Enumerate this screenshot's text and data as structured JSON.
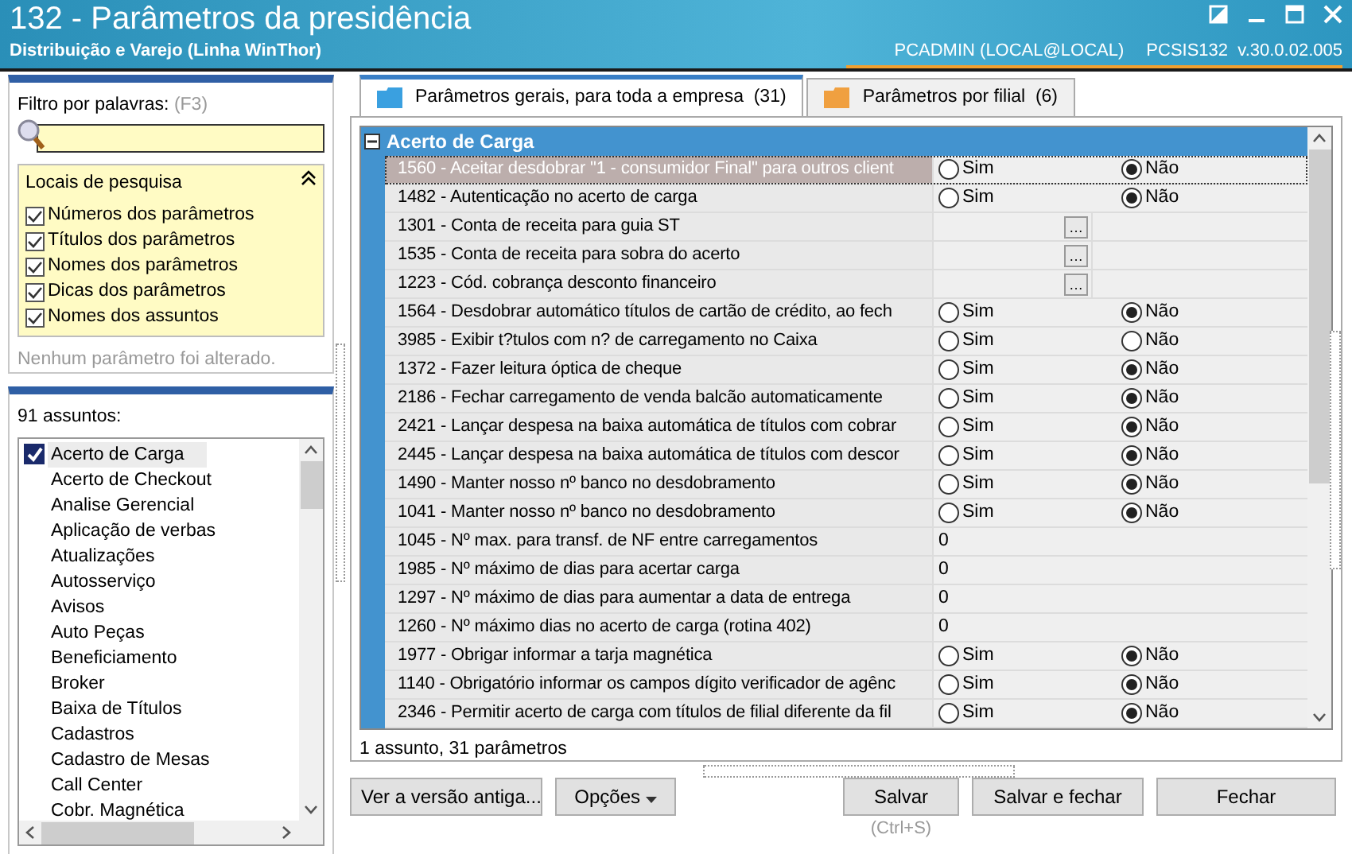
{
  "window": {
    "title": "132 - Parâmetros da presidência",
    "subtitle": "Distribuição e Varejo (Linha WinThor)",
    "user": "PCADMIN (LOCAL@LOCAL)",
    "version": "PCSIS132  v.30.0.02.005"
  },
  "filter": {
    "label": "Filtro por palavras:",
    "shortcut": "(F3)",
    "search_locations": {
      "title": "Locais de pesquisa",
      "expanded": true,
      "options": [
        {
          "label": "Números dos parâmetros",
          "checked": true
        },
        {
          "label": "Títulos dos parâmetros",
          "checked": true
        },
        {
          "label": "Nomes dos parâmetros",
          "checked": true
        },
        {
          "label": "Dicas dos parâmetros",
          "checked": true
        },
        {
          "label": "Nomes dos assuntos",
          "checked": true
        }
      ]
    },
    "status": "Nenhum parâmetro foi alterado."
  },
  "subjects": {
    "count_label": "91 assuntos:",
    "items": [
      {
        "label": "Acerto de Carga",
        "selected": true
      },
      {
        "label": "Acerto de Checkout",
        "selected": false
      },
      {
        "label": "Analise Gerencial",
        "selected": false
      },
      {
        "label": "Aplicação de verbas",
        "selected": false
      },
      {
        "label": "Atualizações",
        "selected": false
      },
      {
        "label": "Autosserviço",
        "selected": false
      },
      {
        "label": "Avisos",
        "selected": false
      },
      {
        "label": "Auto Peças",
        "selected": false
      },
      {
        "label": "Beneficiamento",
        "selected": false
      },
      {
        "label": "Broker",
        "selected": false
      },
      {
        "label": "Baixa de Títulos",
        "selected": false
      },
      {
        "label": "Cadastros",
        "selected": false
      },
      {
        "label": "Cadastro de Mesas",
        "selected": false
      },
      {
        "label": "Call Center",
        "selected": false
      },
      {
        "label": "Cobr. Magnética",
        "selected": false
      }
    ]
  },
  "tabs": [
    {
      "label": "Parâmetros gerais, para toda a empresa",
      "count": "(31)",
      "selected": true
    },
    {
      "label": "Parâmetros por filial",
      "count": "(6)",
      "selected": false
    }
  ],
  "grid": {
    "group": {
      "title": "Acerto de Carga",
      "expanded": true
    },
    "rows": [
      {
        "kind": "yesno",
        "label": "1560 - Aceitar desdobrar \"1 - consumidor Final\" para outros client",
        "selected": true,
        "yes": "Sim",
        "no": "Não",
        "yes_checked": false,
        "no_checked": true
      },
      {
        "kind": "yesno",
        "label": "1482 - Autenticação no acerto de carga",
        "selected": false,
        "yes": "Sim",
        "no": "Não",
        "yes_checked": false,
        "no_checked": true
      },
      {
        "kind": "lookup",
        "label": "1301 - Conta de receita para guia ST",
        "selected": false,
        "button": "…"
      },
      {
        "kind": "lookup",
        "label": "1535 - Conta de receita para sobra do acerto",
        "selected": false,
        "button": "…"
      },
      {
        "kind": "lookup",
        "label": "1223 - Cód. cobrança desconto financeiro",
        "selected": false,
        "button": "…"
      },
      {
        "kind": "yesno",
        "label": "1564 - Desdobrar automático títulos de cartão de crédito, ao fech",
        "selected": false,
        "yes": "Sim",
        "no": "Não",
        "yes_checked": false,
        "no_checked": true
      },
      {
        "kind": "yesno",
        "label": "3985 - Exibir t?tulos com n? de carregamento no Caixa",
        "selected": false,
        "yes": "Sim",
        "no": "Não",
        "yes_checked": false,
        "no_checked": false
      },
      {
        "kind": "yesno",
        "label": "1372 - Fazer leitura óptica de cheque",
        "selected": false,
        "yes": "Sim",
        "no": "Não",
        "yes_checked": false,
        "no_checked": true
      },
      {
        "kind": "yesno",
        "label": "2186 - Fechar carregamento de venda balcão automaticamente",
        "selected": false,
        "yes": "Sim",
        "no": "Não",
        "yes_checked": false,
        "no_checked": true
      },
      {
        "kind": "yesno",
        "label": "2421 - Lançar despesa na baixa automática de títulos com cobrar",
        "selected": false,
        "yes": "Sim",
        "no": "Não",
        "yes_checked": false,
        "no_checked": true
      },
      {
        "kind": "yesno",
        "label": "2445 - Lançar despesa na baixa automática de títulos com descor",
        "selected": false,
        "yes": "Sim",
        "no": "Não",
        "yes_checked": false,
        "no_checked": true
      },
      {
        "kind": "yesno",
        "label": "1490 - Manter nosso nº banco no desdobramento",
        "selected": false,
        "yes": "Sim",
        "no": "Não",
        "yes_checked": false,
        "no_checked": true
      },
      {
        "kind": "yesno",
        "label": "1041 - Manter nosso nº banco no desdobramento",
        "selected": false,
        "yes": "Sim",
        "no": "Não",
        "yes_checked": false,
        "no_checked": true
      },
      {
        "kind": "number",
        "label": "1045 - Nº max. para transf. de NF entre carregamentos",
        "selected": false,
        "value": "0"
      },
      {
        "kind": "number",
        "label": "1985 - Nº máximo de dias para acertar carga",
        "selected": false,
        "value": "0"
      },
      {
        "kind": "number",
        "label": "1297 - Nº máximo de dias para aumentar a data de entrega",
        "selected": false,
        "value": "0"
      },
      {
        "kind": "number",
        "label": "1260 - Nº máximo dias no acerto de carga (rotina 402)",
        "selected": false,
        "value": "0"
      },
      {
        "kind": "yesno",
        "label": "1977 - Obrigar informar a tarja magnética",
        "selected": false,
        "yes": "Sim",
        "no": "Não",
        "yes_checked": false,
        "no_checked": true
      },
      {
        "kind": "yesno",
        "label": "1140 - Obrigatório informar os campos dígito verificador de agênc",
        "selected": false,
        "yes": "Sim",
        "no": "Não",
        "yes_checked": false,
        "no_checked": true
      },
      {
        "kind": "yesno",
        "label": "2346 - Permitir acerto de carga com títulos de filial diferente da fil",
        "selected": false,
        "yes": "Sim",
        "no": "Não",
        "yes_checked": false,
        "no_checked": true
      }
    ]
  },
  "summary": "1 assunto, 31 parâmetros",
  "buttons": [
    {
      "kind": "plain",
      "label": "Ver a versão antiga..."
    },
    {
      "kind": "dropdown",
      "label": "Opções"
    },
    {
      "kind": "plain",
      "label": "Salvar",
      "hint": "(Ctrl+S)"
    },
    {
      "kind": "plain",
      "label": "Salvar e fechar"
    },
    {
      "kind": "plain",
      "label": "Fechar"
    }
  ]
}
